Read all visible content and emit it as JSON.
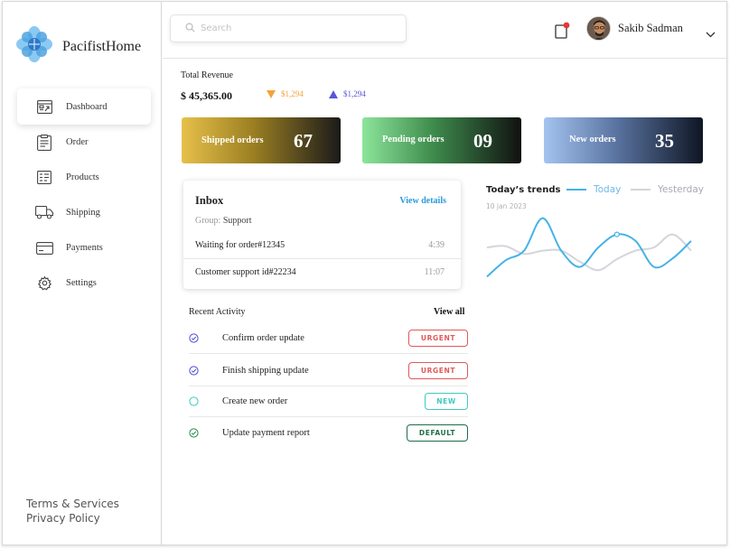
{
  "brand": {
    "name": "PacifistHome",
    "logo_icon": "flower-logo-icon"
  },
  "sidebar": {
    "items": [
      {
        "label": "Dashboard",
        "icon": "dashboard-icon",
        "active": true
      },
      {
        "label": "Order",
        "icon": "order-clipboard-icon",
        "active": false
      },
      {
        "label": "Products",
        "icon": "products-list-icon",
        "active": false
      },
      {
        "label": "Shipping",
        "icon": "truck-icon",
        "active": false
      },
      {
        "label": "Payments",
        "icon": "credit-card-icon",
        "active": false
      },
      {
        "label": "Settings",
        "icon": "gear-icon",
        "active": false
      }
    ],
    "footer": {
      "terms": "Terms & Services",
      "privacy": "Privacy Policy"
    }
  },
  "header": {
    "search_placeholder": "Search",
    "notification_dot_color": "#e53935",
    "user_name": "Sakib Sadman"
  },
  "revenue": {
    "title": "Total Revenue",
    "value": "$ 45,365.00",
    "down_value": "$1,294",
    "up_value": "$1,294",
    "down_color": "#f2a33a",
    "up_color": "#5b55d6"
  },
  "cards": [
    {
      "label": "Shipped orders",
      "value": "67"
    },
    {
      "label": "Pending orders",
      "value": "09"
    },
    {
      "label": "New orders",
      "value": "35"
    }
  ],
  "inbox": {
    "title": "Inbox",
    "view_details": "View details",
    "group_label": "Group:",
    "group_value": "Support",
    "rows": [
      {
        "text": "Waiting for order#12345",
        "time": "4:39"
      },
      {
        "text": "Customer support id#22234",
        "time": "11:07"
      }
    ]
  },
  "trends": {
    "title": "Today’s trends",
    "date": "10 jan 2023",
    "legend_today": "Today",
    "legend_yesterday": "Yesterday",
    "today_color": "#45b3e6",
    "yesterday_color": "#d4d4dc"
  },
  "chart_data": {
    "type": "line",
    "title": "Today’s trends",
    "series": [
      {
        "name": "Today",
        "values": [
          0.05,
          0.3,
          0.45,
          0.95,
          0.45,
          0.2,
          0.5,
          0.7,
          0.6,
          0.2,
          0.33,
          0.6
        ]
      },
      {
        "name": "Yesterday",
        "values": [
          0.5,
          0.52,
          0.4,
          0.45,
          0.45,
          0.28,
          0.15,
          0.32,
          0.45,
          0.5,
          0.7,
          0.45
        ]
      }
    ],
    "grid": false,
    "legend": "top"
  },
  "activity": {
    "title": "Recent Activity",
    "view_all": "View all",
    "items": [
      {
        "label": "Confirm order update",
        "badge": "URGENT",
        "kind": "urgent",
        "check_color": "#4a4ad6"
      },
      {
        "label": "Finish shipping update",
        "badge": "URGENT",
        "kind": "urgent",
        "check_color": "#4a4ad6"
      },
      {
        "label": "Create new order",
        "badge": "NEW",
        "kind": "new",
        "check_color": "#3ccac0"
      },
      {
        "label": "Update payment report",
        "badge": "DEFAULT",
        "kind": "default",
        "check_color": "#1e8a4a"
      }
    ]
  }
}
